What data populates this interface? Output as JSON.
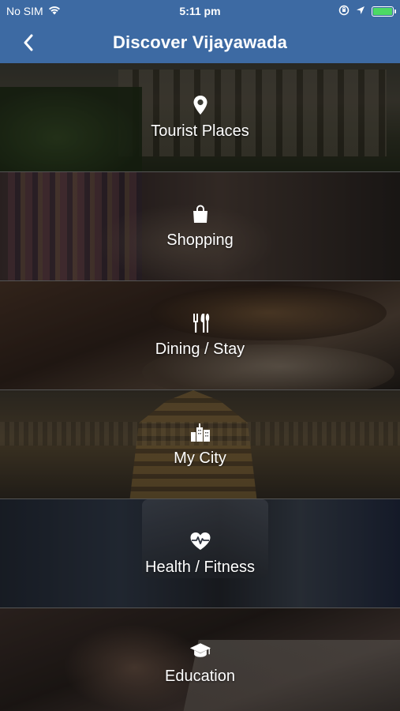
{
  "status_bar": {
    "carrier": "No SIM",
    "time": "5:11 pm",
    "battery_level": 1.0,
    "icons": [
      "wifi-icon",
      "orientation-lock-icon",
      "location-arrow-icon",
      "battery-icon"
    ]
  },
  "nav": {
    "title": "Discover Vijayawada",
    "back_icon": "chevron-left-icon"
  },
  "categories": [
    {
      "label": "Tourist Places",
      "icon": "map-pin-icon"
    },
    {
      "label": "Shopping",
      "icon": "shopping-bag-icon"
    },
    {
      "label": "Dining / Stay",
      "icon": "fork-knife-icon"
    },
    {
      "label": "My City",
      "icon": "buildings-icon"
    },
    {
      "label": "Health / Fitness",
      "icon": "heart-pulse-icon"
    },
    {
      "label": "Education",
      "icon": "graduation-cap-icon"
    }
  ],
  "colors": {
    "nav_bar": "#3d6aa3",
    "battery": "#4cd964",
    "text": "#ffffff"
  }
}
